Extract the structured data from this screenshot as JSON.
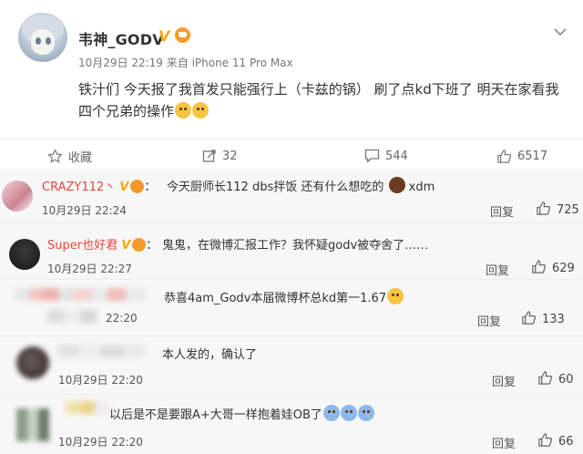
{
  "post": {
    "author": "韦神_GODV",
    "verified_mark": "V",
    "meta": "10月29日 22:19 来自 iPhone 11 Pro Max",
    "text_line1": "铁汁们 今天报了我首发只能强行上（卡兹的锅） 刷了点kd下班了 明天在家看我",
    "text_line2": "四个兄弟的操作"
  },
  "actions": {
    "favorite_label": "收藏",
    "repost_count": "32",
    "comment_count": "544",
    "like_count": "6517"
  },
  "comments": [
    {
      "name": "CRAZY112丶",
      "name_color": "#e8453c",
      "text": "今天厨师长112 dbs拌饭 还有什么想吃的",
      "text_suffix": "xdm",
      "time": "10月29日 22:24",
      "reply_label": "回复",
      "likes": "725"
    },
    {
      "name": "Super也好君",
      "name_color": "#e8453c",
      "text": "鬼鬼，在微博汇报工作？我怀疑godv被夺舍了……",
      "time": "10月29日 22:27",
      "reply_label": "回复",
      "likes": "629"
    },
    {
      "name": "",
      "text": "恭喜4am_Godv本届微博杯总kd第一1.67",
      "time": "22:20",
      "reply_label": "回复",
      "likes": "133"
    },
    {
      "name": "",
      "text": "本人发的，确认了",
      "time": "10月29日 22:20",
      "reply_label": "回复",
      "likes": "60"
    },
    {
      "name": "",
      "text": "以后是不是要跟A+大哥一样抱着娃OB了",
      "time": "10月29日 22:20",
      "reply_label": "回复",
      "likes": "66"
    }
  ],
  "icons": {
    "more": "chevron-down-icon",
    "favorite": "star-icon",
    "repost": "repost-icon",
    "comment": "comment-icon",
    "like": "thumbs-up-icon"
  },
  "colors": {
    "name_red": "#e8453c",
    "verified_gold": "#f2a90c",
    "comment_bg": "#f7f7f7"
  }
}
